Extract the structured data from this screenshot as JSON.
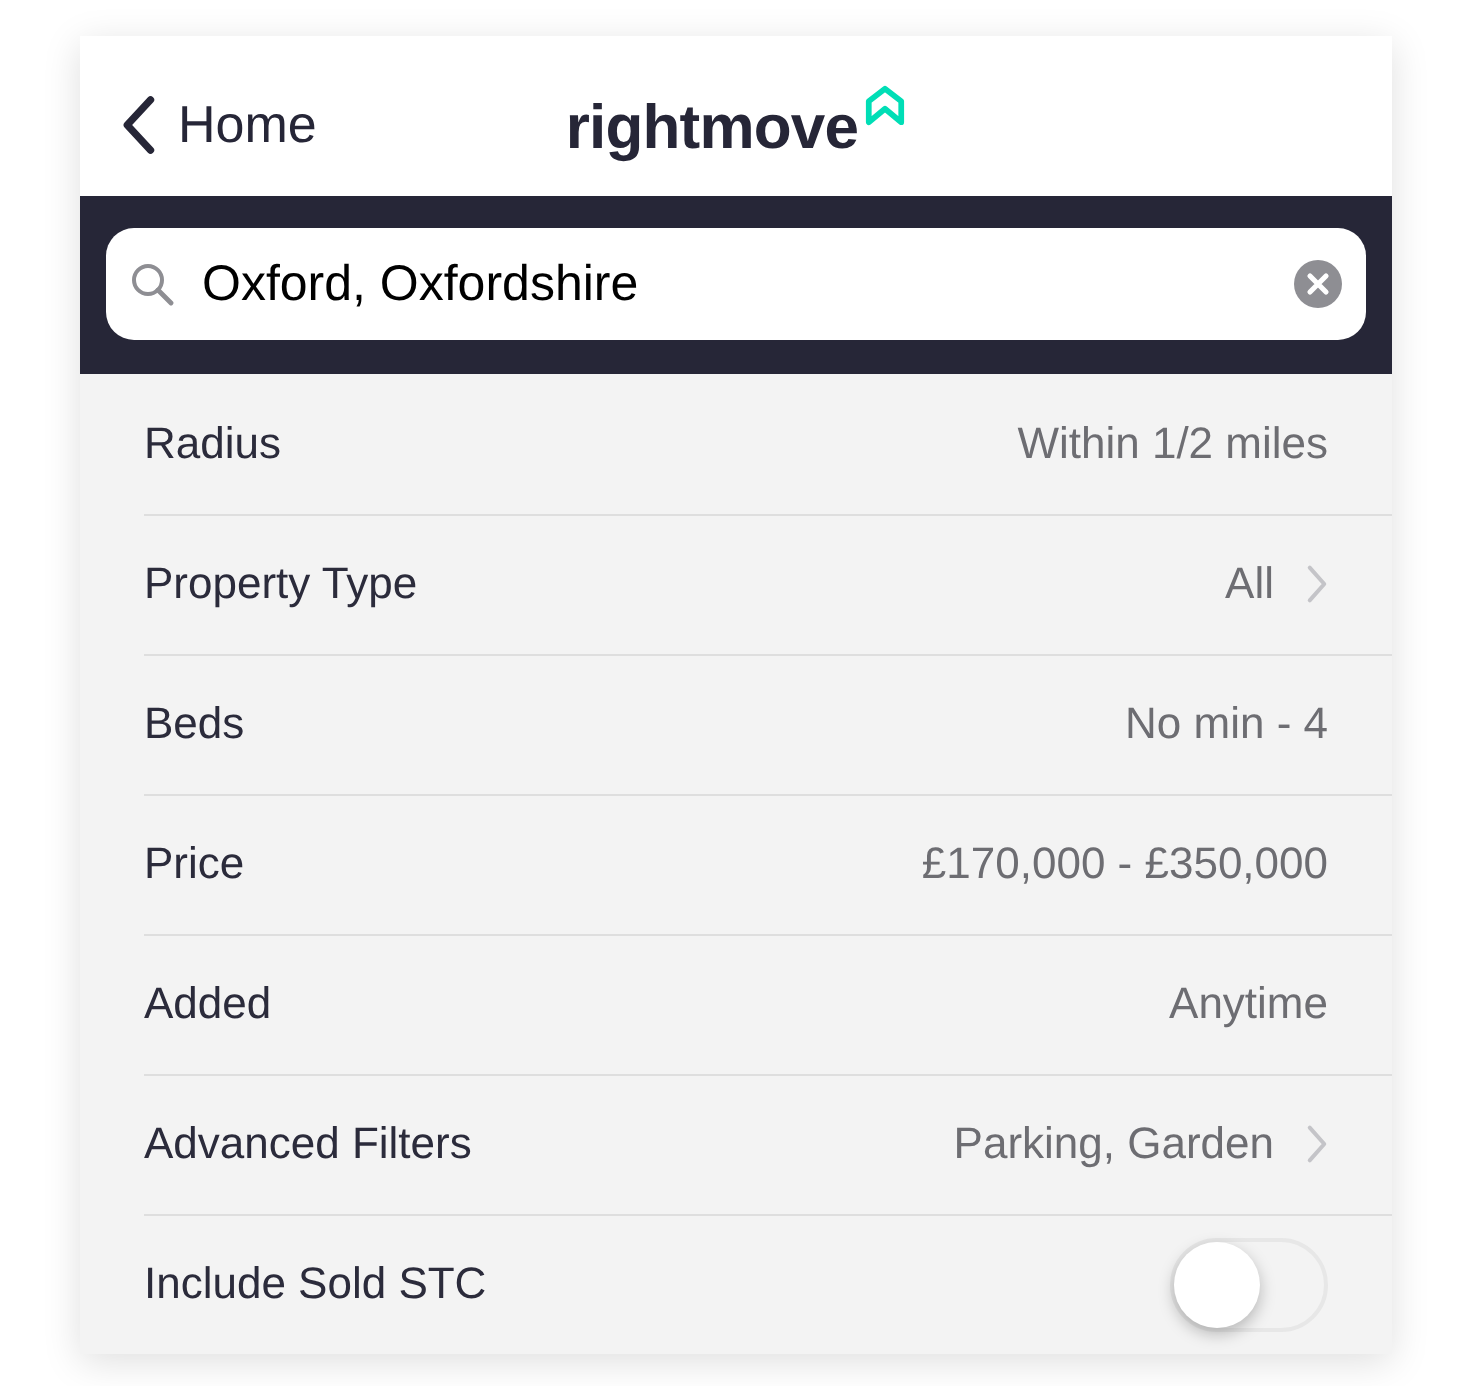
{
  "nav": {
    "back_label": "Home",
    "logo": "rightmove"
  },
  "search": {
    "value": "Oxford, Oxfordshire"
  },
  "filters": [
    {
      "kind": "value",
      "label": "Radius",
      "value": "Within 1/2 miles"
    },
    {
      "kind": "link",
      "label": "Property Type",
      "value": "All"
    },
    {
      "kind": "value",
      "label": "Beds",
      "value": "No min - 4"
    },
    {
      "kind": "value",
      "label": "Price",
      "value": "£170,000 - £350,000"
    },
    {
      "kind": "value",
      "label": "Added",
      "value": "Anytime"
    },
    {
      "kind": "link",
      "label": "Advanced Filters",
      "value": "Parking, Garden"
    },
    {
      "kind": "toggle",
      "label": "Include Sold STC",
      "on": false
    }
  ]
}
